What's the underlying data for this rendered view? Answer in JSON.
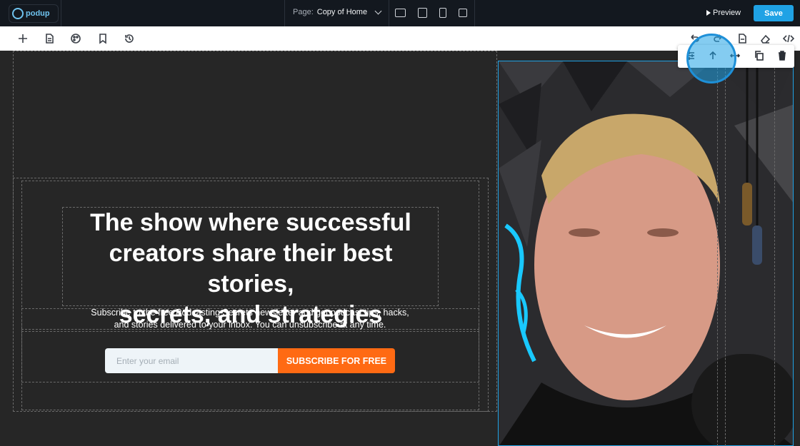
{
  "topbar": {
    "logo_text": "podup",
    "page_label": "Page:",
    "page_value": "Copy of Home",
    "preview_label": "Preview",
    "save_label": "Save"
  },
  "hero": {
    "headline_line1": "The show where successful",
    "headline_line2": "creators share their best stories,",
    "headline_line3": "secrets, and strategies",
    "subtext_line1": "Subscribe to the free Podcasting Secrets newsletter and get podcast tips, hacks,",
    "subtext_line2": "and stories delivered to your inbox. You can unsubscribe at any time.",
    "email_placeholder": "Enter your email",
    "subscribe_label": "SUBSCRIBE FOR FREE"
  },
  "colors": {
    "accent": "#1fa2e5",
    "cta": "#ff6a13",
    "canvas_bg": "#262626",
    "topbar_bg": "#13181f"
  },
  "icons": {
    "toolbar": [
      "add-icon",
      "page-icon",
      "palette-icon",
      "bookmark-icon",
      "history-icon",
      "undo-icon",
      "redo-icon",
      "export-icon",
      "eraser-icon",
      "code-icon"
    ],
    "element_toolbar": [
      "settings-icon",
      "move-up-icon",
      "resize-icon",
      "duplicate-icon",
      "delete-icon"
    ],
    "devices": [
      "desktop-icon",
      "tablet-icon",
      "mobile-icon",
      "square-icon"
    ]
  }
}
